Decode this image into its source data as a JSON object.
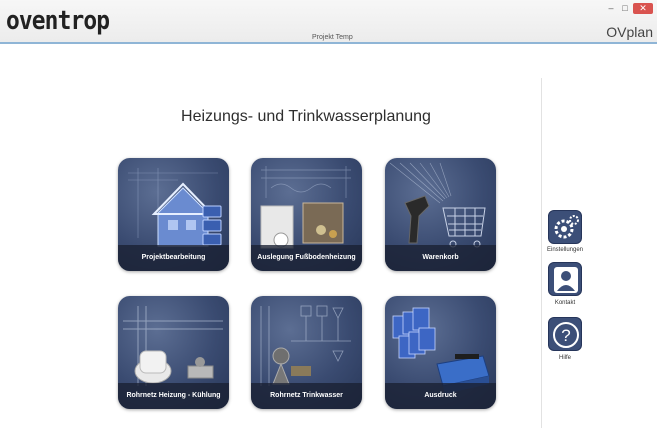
{
  "window": {
    "logo": "oventrop",
    "project": "Projekt Temp",
    "app_title": "OVplan",
    "minimize": "–",
    "maximize": "□",
    "close": "✕"
  },
  "main": {
    "title": "Heizungs- und Trinkwasserplanung",
    "tiles": [
      {
        "label": "Projektbearbeitung",
        "icon": "house-folders-icon"
      },
      {
        "label": "Auslegung Fußbodenheizung",
        "icon": "floor-heating-icon"
      },
      {
        "label": "Warenkorb",
        "icon": "barcode-cart-icon"
      },
      {
        "label": "Rohrnetz Heizung - Kühlung",
        "icon": "thermostat-valve-icon"
      },
      {
        "label": "Rohrnetz Trinkwasser",
        "icon": "water-fittings-icon"
      },
      {
        "label": "Ausdruck",
        "icon": "printer-icon"
      }
    ]
  },
  "sidebar": {
    "items": [
      {
        "label": "Einstellungen",
        "icon": "gear-icon"
      },
      {
        "label": "Kontakt",
        "icon": "person-icon"
      },
      {
        "label": "Hilfe",
        "icon": "help-icon"
      }
    ]
  }
}
